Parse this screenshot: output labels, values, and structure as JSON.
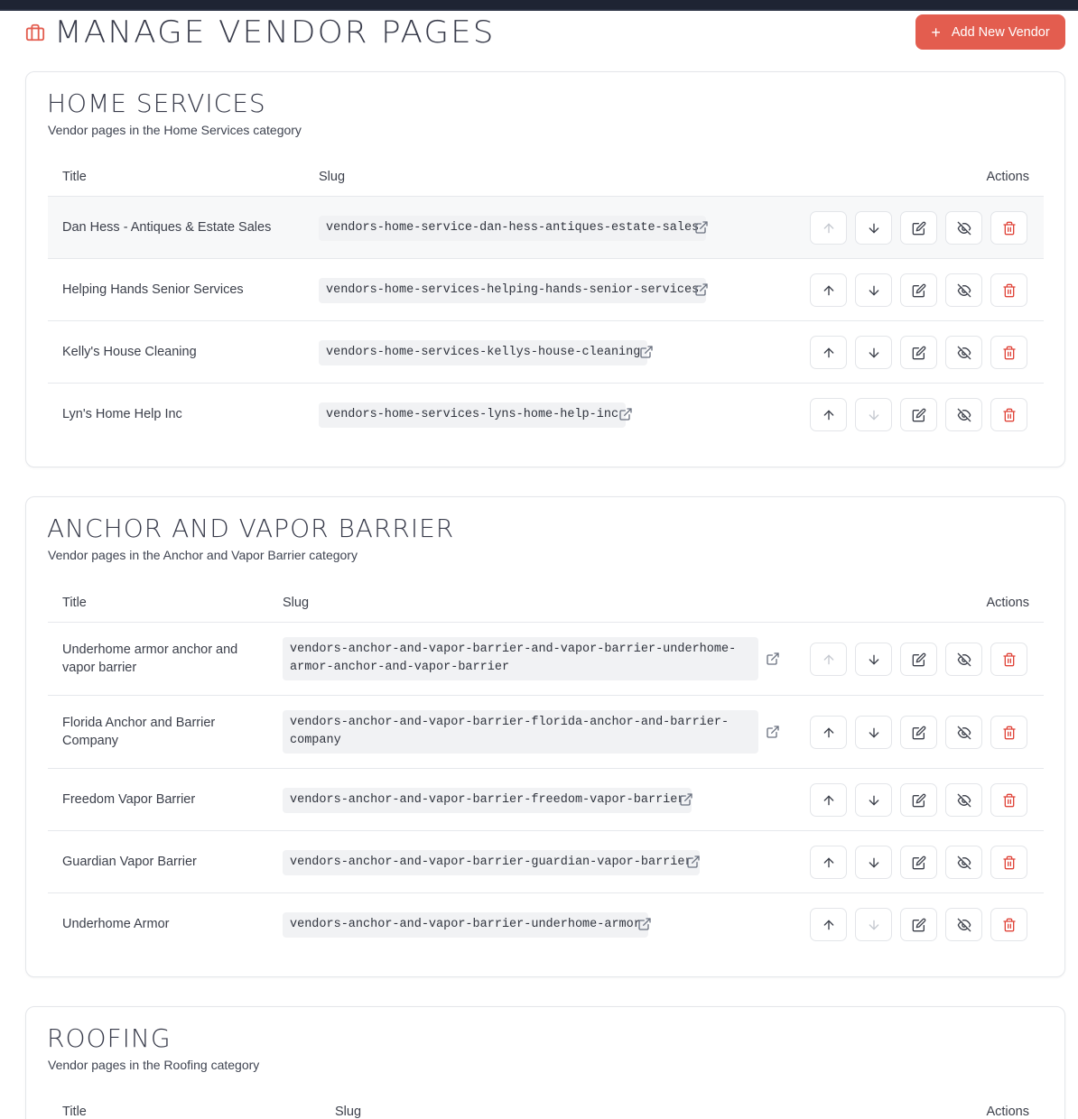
{
  "header": {
    "title": "Manage Vendor Pages",
    "add_button": "Add New Vendor",
    "add_icon": "plus-icon",
    "title_icon": "briefcase-icon",
    "accent_color": "#e35d4f"
  },
  "table_headers": {
    "title": "Title",
    "slug": "Slug",
    "actions": "Actions"
  },
  "sections": [
    {
      "name": "Home Services",
      "description": "Vendor pages in the Home Services category",
      "rows": [
        {
          "title": "Dan Hess - Antiques & Estate Sales",
          "slug": "vendors-home-service-dan-hess-antiques-estate-sales"
        },
        {
          "title": "Helping Hands Senior Services",
          "slug": "vendors-home-services-helping-hands-senior-services"
        },
        {
          "title": "Kelly's House Cleaning",
          "slug": "vendors-home-services-kellys-house-cleaning"
        },
        {
          "title": "Lyn's Home Help Inc",
          "slug": "vendors-home-services-lyns-home-help-inc"
        }
      ]
    },
    {
      "name": "Anchor and Vapor Barrier",
      "description": "Vendor pages in the Anchor and Vapor Barrier category",
      "rows": [
        {
          "title_l1": "Underhome armor anchor and",
          "title_l2": "vapor barrier",
          "slug_l1": "vendors-anchor-and-vapor-barrier-and-vapor-barrier-underhome-",
          "slug_l2": "armor-anchor-and-vapor-barrier"
        },
        {
          "title_l1": "Florida Anchor and Barrier",
          "title_l2": "Company",
          "slug_l1": "vendors-anchor-and-vapor-barrier-florida-anchor-and-barrier-",
          "slug_l2": "company"
        },
        {
          "title": "Freedom Vapor Barrier",
          "slug": "vendors-anchor-and-vapor-barrier-freedom-vapor-barrier"
        },
        {
          "title": "Guardian Vapor Barrier",
          "slug": "vendors-anchor-and-vapor-barrier-guardian-vapor-barrier"
        },
        {
          "title": "Underhome Armor",
          "slug": "vendors-anchor-and-vapor-barrier-underhome-armor"
        }
      ]
    },
    {
      "name": "Roofing",
      "description": "Vendor pages in the Roofing category",
      "rows": []
    }
  ],
  "action_icons": [
    "arrow-up-icon",
    "arrow-down-icon",
    "edit-icon",
    "eye-off-icon",
    "trash-icon"
  ],
  "colors": {
    "danger": "#e0453a",
    "muted": "#c4c8cf",
    "text": "#3b3f4a"
  }
}
